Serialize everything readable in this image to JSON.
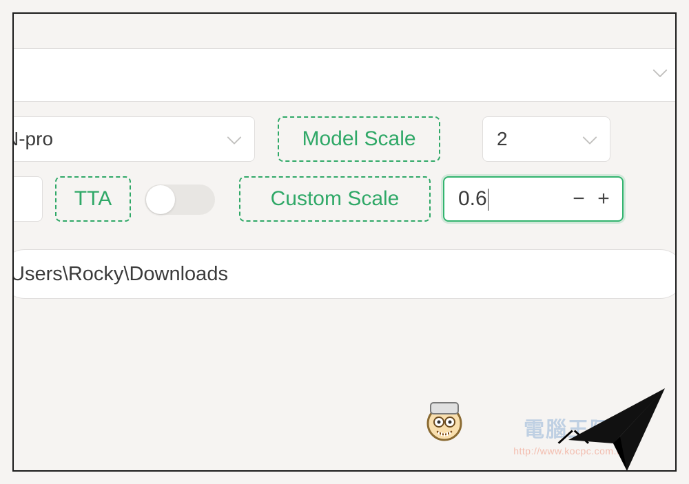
{
  "row1": {
    "value": ""
  },
  "model": {
    "value": "N-pro"
  },
  "model_scale": {
    "label": "Model Scale",
    "value": "2"
  },
  "tta": {
    "label": "TTA",
    "on": false
  },
  "custom_scale": {
    "label": "Custom Scale",
    "value": "0.6"
  },
  "path": {
    "value": "\\Users\\Rocky\\Downloads"
  },
  "watermark": {
    "text": "電腦王阿達",
    "url": "http://www.kocpc.com.tw"
  },
  "glyphs": {
    "minus": "−",
    "plus": "+"
  }
}
